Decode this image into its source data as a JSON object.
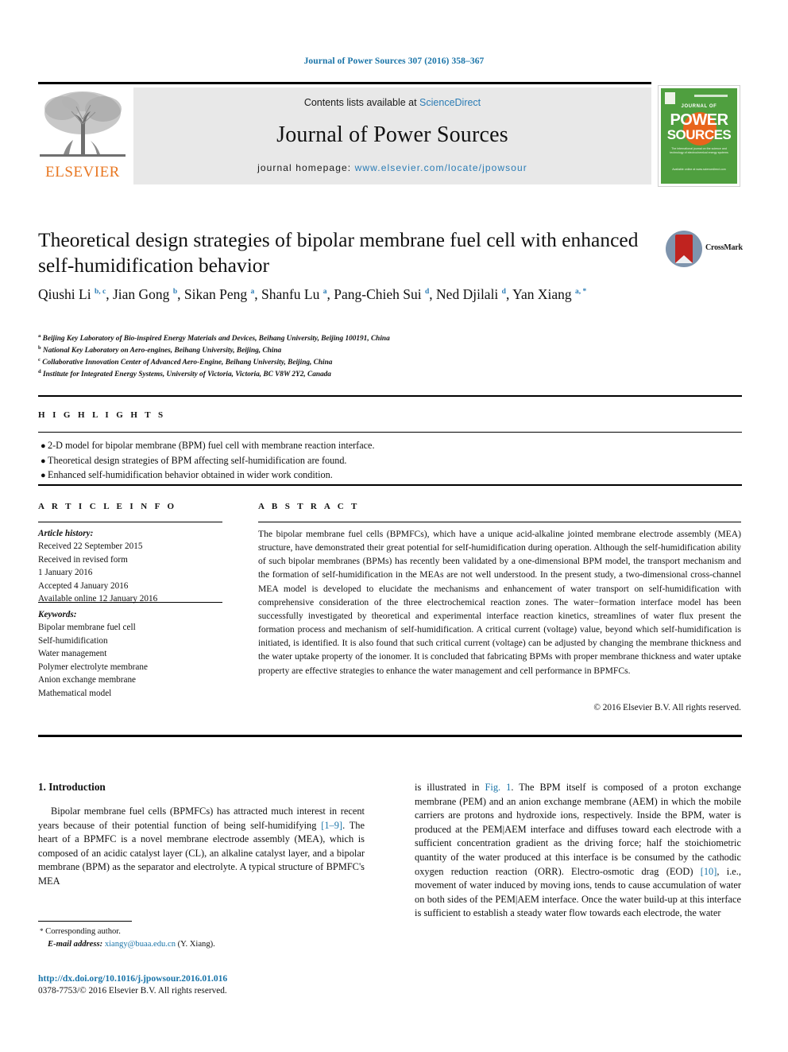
{
  "running_head": "Journal of Power Sources 307 (2016) 358–367",
  "masthead": {
    "contents_prefix": "Contents lists available at ",
    "sciencedirect": "ScienceDirect",
    "journal_title": "Journal of Power Sources",
    "homepage_label": "journal homepage:",
    "homepage_url": "www.elsevier.com/locate/jpowsour",
    "publisher_wordmark": "ELSEVIER",
    "publisher_logo_icon": "elsevier-tree-icon",
    "link_color": "#2b7cb5",
    "band_color": "#e8e8e8"
  },
  "cover": {
    "journal_of": "JOURNAL OF",
    "line1": "POWER",
    "line2": "SOURCES",
    "blurb": "The international journal on the science and technology of electrochemical energy systems",
    "footer": "Available online at www.sciencedirect.com",
    "background_color": "#4f9f3f",
    "accent_color": "#e8641c"
  },
  "article": {
    "title": "Theoretical design strategies of bipolar membrane fuel cell with enhanced self-humidification behavior",
    "crossmark_label": "CrossMark",
    "authors": [
      {
        "name": "Qiushi Li",
        "marks": "b, c"
      },
      {
        "name": "Jian Gong",
        "marks": "b"
      },
      {
        "name": "Sikan Peng",
        "marks": "a"
      },
      {
        "name": "Shanfu Lu",
        "marks": "a"
      },
      {
        "name": "Pang-Chieh Sui",
        "marks": "d"
      },
      {
        "name": "Ned Djilali",
        "marks": "d"
      },
      {
        "name": "Yan Xiang",
        "marks": "a, *"
      }
    ],
    "affiliations": [
      {
        "mark": "a",
        "text": "Beijing Key Laboratory of Bio-inspired Energy Materials and Devices, Beihang University, Beijing 100191, China"
      },
      {
        "mark": "b",
        "text": "National Key Laboratory on Aero-engines, Beihang University, Beijing, China"
      },
      {
        "mark": "c",
        "text": "Collaborative Innovation Center of Advanced Aero-Engine, Beihang University, Beijing, China"
      },
      {
        "mark": "d",
        "text": "Institute for Integrated Energy Systems, University of Victoria, Victoria, BC V8W 2Y2, Canada"
      }
    ]
  },
  "highlights": {
    "heading": "H I G H L I G H T S",
    "items": [
      "2-D model for bipolar membrane (BPM) fuel cell with membrane reaction interface.",
      "Theoretical design strategies of BPM affecting self-humidification are found.",
      "Enhanced self-humidification behavior obtained in wider work condition."
    ]
  },
  "article_info": {
    "heading": "A R T I C L E   I N F O",
    "history_label": "Article history:",
    "history": [
      "Received 22 September 2015",
      "Received in revised form",
      "1 January 2016",
      "Accepted 4 January 2016",
      "Available online 12 January 2016"
    ],
    "keywords_label": "Keywords:",
    "keywords": [
      "Bipolar membrane fuel cell",
      "Self-humidification",
      "Water management",
      "Polymer electrolyte membrane",
      "Anion exchange membrane",
      "Mathematical model"
    ]
  },
  "abstract": {
    "heading": "A B S T R A C T",
    "text": "The bipolar membrane fuel cells (BPMFCs), which have a unique acid-alkaline jointed membrane electrode assembly (MEA) structure, have demonstrated their great potential for self-humidification during operation. Although the self-humidification ability of such bipolar membranes (BPMs) has recently been validated by a one-dimensional BPM model, the transport mechanism and the formation of self-humidification in the MEAs are not well understood. In the present study, a two-dimensional cross-channel MEA model is developed to elucidate the mechanisms and enhancement of water transport on self-humidification with comprehensive consideration of the three electrochemical reaction zones. The water−formation interface model has been successfully investigated by theoretical and experimental interface reaction kinetics, streamlines of water flux present the formation process and mechanism of self-humidification. A critical current (voltage) value, beyond which self-humidification is initiated, is identified. It is also found that such critical current (voltage) can be adjusted by changing the membrane thickness and the water uptake property of the ionomer. It is concluded that fabricating BPMs with proper membrane thickness and water uptake property are effective strategies to enhance the water management and cell performance in BPMFCs.",
    "copyright": "© 2016 Elsevier B.V. All rights reserved."
  },
  "body": {
    "section_number_title": "1. Introduction",
    "left_paragraph_part1": "Bipolar membrane fuel cells (BPMFCs) has attracted much interest in recent years because of their potential function of being self-humidifying ",
    "left_ref1": "[1–9]",
    "left_paragraph_part2": ". The heart of a BPMFC is a novel membrane electrode assembly (MEA), which is composed of an acidic catalyst layer (CL), an alkaline catalyst layer, and a bipolar membrane (BPM) as the separator and electrolyte. A typical structure of BPMFC's MEA",
    "right_part1": "is illustrated in ",
    "right_figref": "Fig. 1",
    "right_part2": ". The BPM itself is composed of a proton exchange membrane (PEM) and an anion exchange membrane (AEM) in which the mobile carriers are protons and hydroxide ions, respectively. Inside the BPM, water is produced at the PEM|AEM interface and diffuses toward each electrode with a sufficient concentration gradient as the driving force; half the stoichiometric quantity of the water produced at this interface is be consumed by the cathodic oxygen reduction reaction (ORR). Electro-osmotic drag (EOD) ",
    "right_ref": "[10]",
    "right_part3": ", i.e., movement of water induced by moving ions, tends to cause accumulation of water on both sides of the PEM|AEM interface. Once the water build-up at this interface is sufficient to establish a steady water flow towards each electrode, the water"
  },
  "footer": {
    "corresponding_label": "Corresponding author.",
    "email_label": "E-mail address:",
    "email": "xiangy@buaa.edu.cn",
    "email_owner": "(Y. Xiang).",
    "doi_url": "http://dx.doi.org/10.1016/j.jpowsour.2016.01.016",
    "issn_line": "0378-7753/© 2016 Elsevier B.V. All rights reserved."
  }
}
